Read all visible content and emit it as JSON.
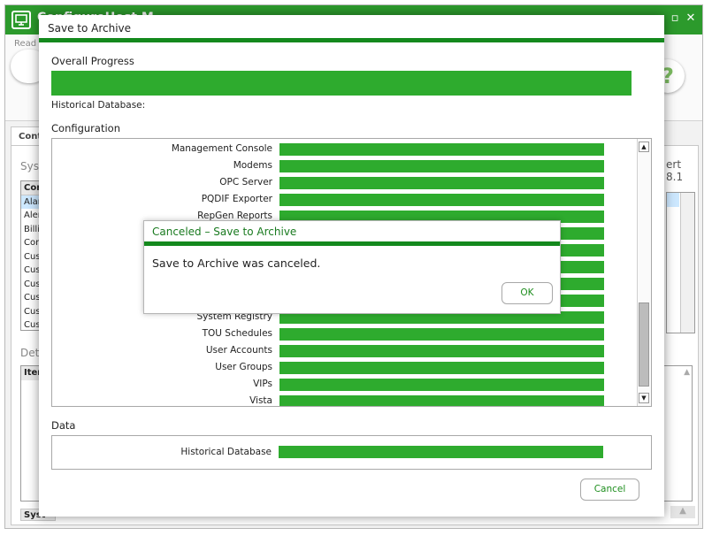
{
  "main_window": {
    "title": "ConfigureHost M",
    "ribbon_read_label": "Read",
    "help_glyph": "?",
    "tab_label": "Conte",
    "system_label": "Syste",
    "version_label": "ert 8.1",
    "details_label": "Deta",
    "items_header": "Item",
    "bottom_bar_label": "Syst",
    "components": [
      "Com",
      "Alarm",
      "Alert",
      "Billin",
      "Conn",
      "Custo",
      "Custo",
      "Custo",
      "Custo",
      "Custo",
      "Custo"
    ],
    "brand_color": "#2c9a2c",
    "icons": [
      "monitor-icon",
      "minimize-icon",
      "restore-icon",
      "close-icon",
      "help-icon"
    ]
  },
  "save_dialog": {
    "title": "Save to Archive",
    "overall_progress_label": "Overall Progress",
    "overall_progress_fraction": 1.0,
    "overall_progress_item": "Historical Database:",
    "configuration_label": "Configuration",
    "configuration_items": [
      {
        "name": "Management Console",
        "progress": 1.0
      },
      {
        "name": "Modems",
        "progress": 1.0
      },
      {
        "name": "OPC Server",
        "progress": 1.0
      },
      {
        "name": "PQDIF Exporter",
        "progress": 1.0
      },
      {
        "name": "RepGen Reports",
        "progress": 1.0
      },
      {
        "name": "",
        "progress": 1.0
      },
      {
        "name": "",
        "progress": 1.0
      },
      {
        "name": "",
        "progress": 1.0
      },
      {
        "name": "",
        "progress": 1.0
      },
      {
        "name": "",
        "progress": 1.0
      },
      {
        "name": "System Registry",
        "progress": 1.0
      },
      {
        "name": "TOU Schedules",
        "progress": 1.0
      },
      {
        "name": "User Accounts",
        "progress": 1.0
      },
      {
        "name": "User Groups",
        "progress": 1.0
      },
      {
        "name": "VIPs",
        "progress": 1.0
      },
      {
        "name": "Vista",
        "progress": 1.0
      }
    ],
    "data_label": "Data",
    "data_items": [
      {
        "name": "Historical Database",
        "progress": 1.0
      }
    ],
    "cancel_label": "Cancel",
    "accent_color": "#14891d",
    "bar_color": "#2eab2e"
  },
  "canceled_dialog": {
    "title": "Canceled – Save to Archive",
    "message": "Save to Archive was canceled.",
    "ok_label": "OK"
  }
}
